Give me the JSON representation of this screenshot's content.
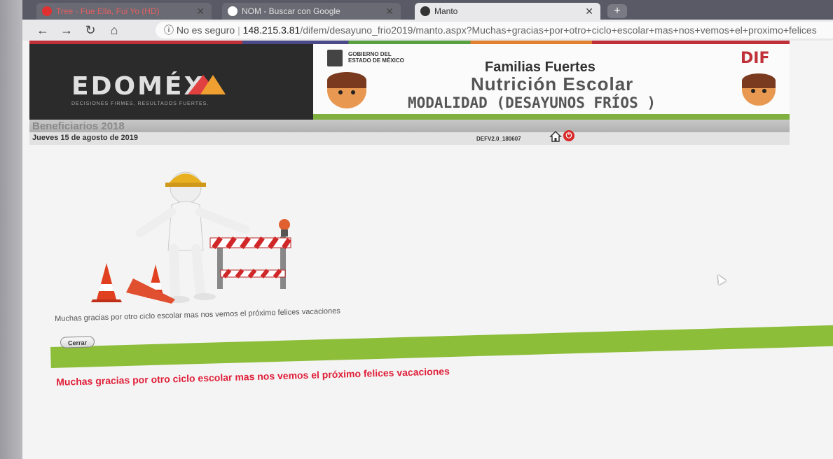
{
  "browser": {
    "tabs": [
      {
        "label": "Tree - Fue Ella, Fui Yo (HD)",
        "icon": "youtube-icon",
        "active": false
      },
      {
        "label": "NOM - Buscar con Google",
        "icon": "google-icon",
        "active": false
      },
      {
        "label": "Manto",
        "icon": "chrome-icon",
        "active": true
      }
    ],
    "new_tab_label": "+",
    "security_label": "No es seguro",
    "url_host": "148.215.3.81",
    "url_path": "/difem/desayuno_frio2019/manto.aspx?Muchas+gracias+por+otro+ciclo+escolar+mas+nos+vemos+el+proximo+felices"
  },
  "header": {
    "edomex_logo": "EDOMÉX",
    "edomex_tagline": "DECISIONES FIRMES, RESULTADOS FUERTES.",
    "gobierno_label": "GOBIERNO DEL ESTADO DE MÉXICO",
    "title_line1": "Familias Fuertes",
    "title_line2": "Nutrición Escolar",
    "title_line3": "MODALIDAD (DESAYUNOS FRÍOS )",
    "dif_logo": "DIF"
  },
  "info_bar": {
    "section_title": "Beneficiarios 2018",
    "date": "Jueves 15 de agosto de 2019",
    "version": "DEFV2.0_180607"
  },
  "main": {
    "message": "Muchas gracias por otro ciclo escolar mas nos vemos el próximo felices vacaciones",
    "close_button": "Cerrar",
    "footer_message": "Muchas gracias por otro ciclo escolar mas nos vemos el próximo felices vacaciones"
  },
  "colors": {
    "accent_green": "#8dbe3a",
    "alert_red": "#e0203a",
    "banner_dark": "#2b2b2b"
  }
}
